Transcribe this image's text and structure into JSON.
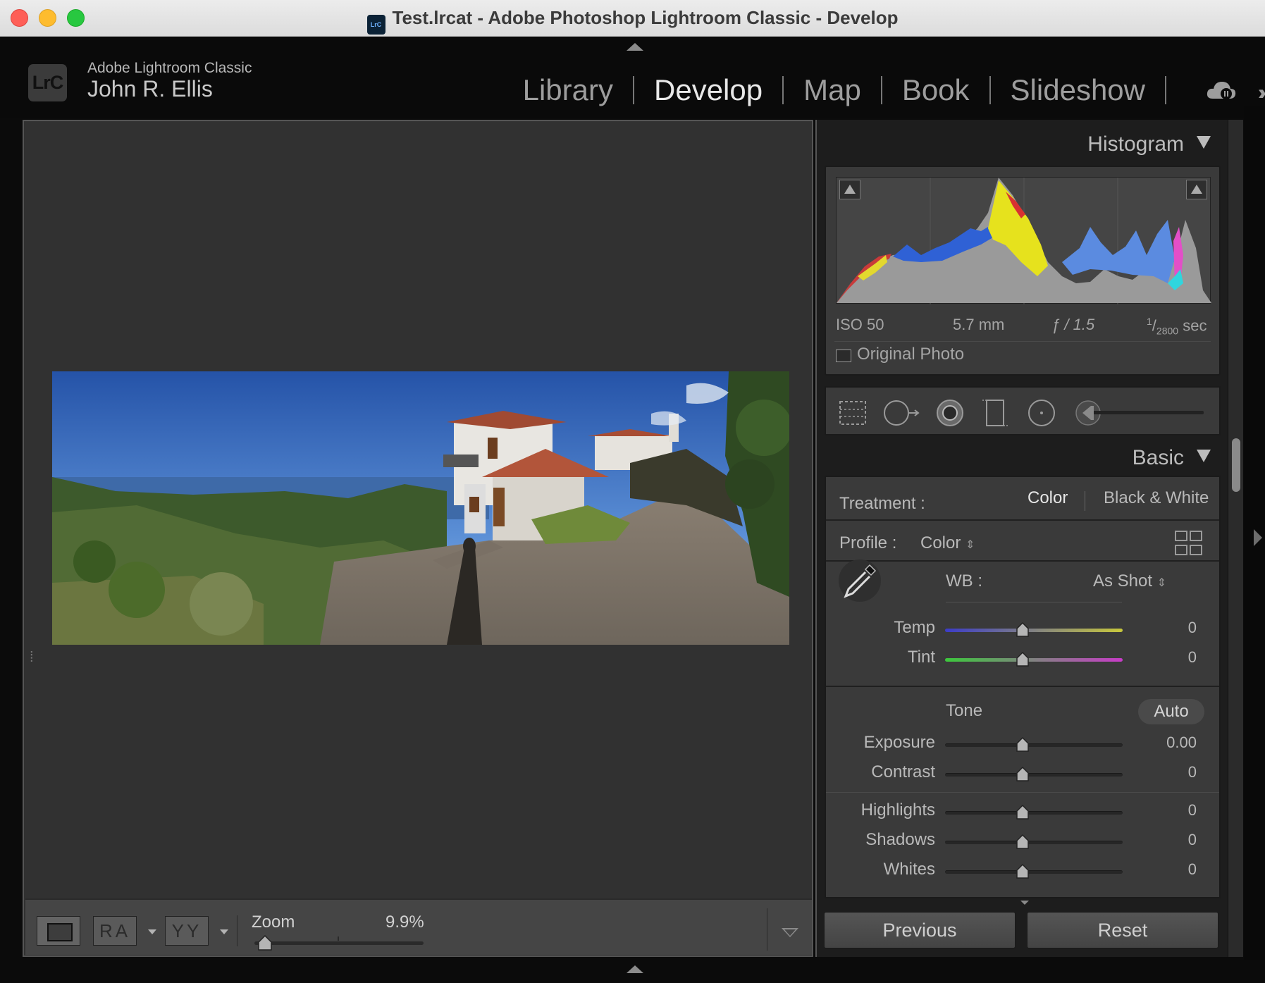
{
  "window": {
    "title": "Test.lrcat - Adobe Photoshop Lightroom Classic - Develop",
    "icon_label": "LrC"
  },
  "identity": {
    "badge": "LrC",
    "app_name": "Adobe Lightroom Classic",
    "user_name": "John R. Ellis"
  },
  "modules": [
    {
      "label": "Library",
      "active": false
    },
    {
      "label": "Develop",
      "active": true
    },
    {
      "label": "Map",
      "active": false
    },
    {
      "label": "Book",
      "active": false
    },
    {
      "label": "Slideshow",
      "active": false
    }
  ],
  "toolbar": {
    "before_after_label": "RA",
    "yy_label": "YY",
    "zoom_label": "Zoom",
    "zoom_value": "9.9%"
  },
  "histogram": {
    "header": "Histogram",
    "iso": "ISO 50",
    "focal_length": "5.7 mm",
    "aperture": "ƒ / 1.5",
    "shutter_numerator": "1",
    "shutter_denominator": "2800",
    "shutter_unit": "sec",
    "original_photo_label": "Original Photo",
    "original_photo_checked": false
  },
  "tools": [
    "crop-tool-icon",
    "spot-removal-icon",
    "red-eye-icon",
    "masking-icon",
    "gradient-icon",
    "brush-slider-icon"
  ],
  "basic": {
    "header": "Basic",
    "treatment_label": "Treatment :",
    "treatment_color": "Color",
    "treatment_bw": "Black & White",
    "profile_label": "Profile :",
    "profile_value": "Color",
    "wb_label": "WB :",
    "wb_value": "As Shot",
    "tone_label": "Tone",
    "auto_label": "Auto",
    "sliders": {
      "temp": {
        "label": "Temp",
        "value": "0",
        "position": 0.5
      },
      "tint": {
        "label": "Tint",
        "value": "0",
        "position": 0.5
      },
      "exposure": {
        "label": "Exposure",
        "value": "0.00",
        "position": 0.5
      },
      "contrast": {
        "label": "Contrast",
        "value": "0",
        "position": 0.5
      },
      "highlights": {
        "label": "Highlights",
        "value": "0",
        "position": 0.5
      },
      "shadows": {
        "label": "Shadows",
        "value": "0",
        "position": 0.5
      },
      "whites": {
        "label": "Whites",
        "value": "0",
        "position": 0.5
      }
    }
  },
  "buttons": {
    "previous": "Previous",
    "reset": "Reset"
  },
  "colors": {
    "accent_active": "#e8e8e8",
    "panel_bg": "#3a3a3a",
    "temp_gradient": [
      "#3c3cc8",
      "#c8c83c"
    ],
    "tint_gradient": [
      "#3cc83c",
      "#c83cc8"
    ]
  }
}
